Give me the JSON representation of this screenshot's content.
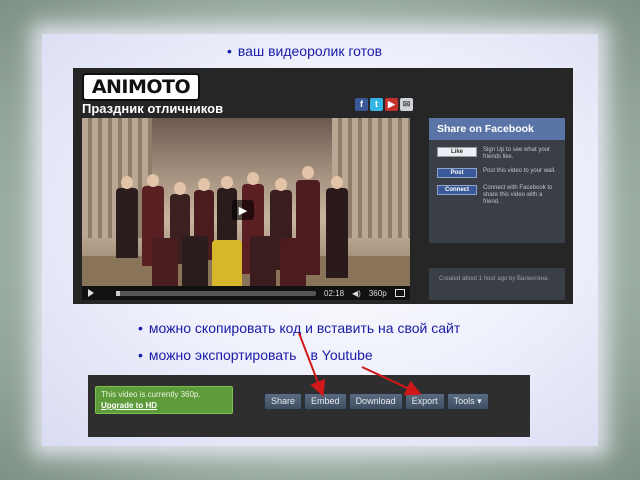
{
  "bullets": {
    "ready": "ваш видеоролик готов",
    "copy_code": "можно скопировать код и вставить на свой сайт",
    "export_prefix": "можно экспортировать",
    "export_suffix": "в Youtube"
  },
  "bullet_glyph": "•",
  "animoto": {
    "logo": "ANIMOTO",
    "video_title": "Праздник отличников",
    "player": {
      "time": "02:18",
      "quality": "360p",
      "progress": 0.02
    },
    "share": {
      "heading": "Share on Facebook",
      "rows": [
        {
          "button": "Like",
          "text": "Sign Up to see what your friends like."
        },
        {
          "button": "Post",
          "text": "Post this video to your wall."
        },
        {
          "button": "Connect",
          "text": "Connect with Facebook to share this video with a friend."
        }
      ]
    },
    "created": "Created about 1 hour ago by Валентина."
  },
  "toolbar": {
    "status_line": "This video is currently 360p.",
    "upgrade_link": "Upgrade to HD",
    "buttons": [
      "Share",
      "Embed",
      "Download",
      "Export",
      "Tools"
    ],
    "tools_caret": "▾"
  },
  "colors": {
    "bullet_text": "#1a1aa8",
    "arrow": "#d01818",
    "facebook": "#3b5998",
    "hd_green": "#5e9b3a"
  }
}
